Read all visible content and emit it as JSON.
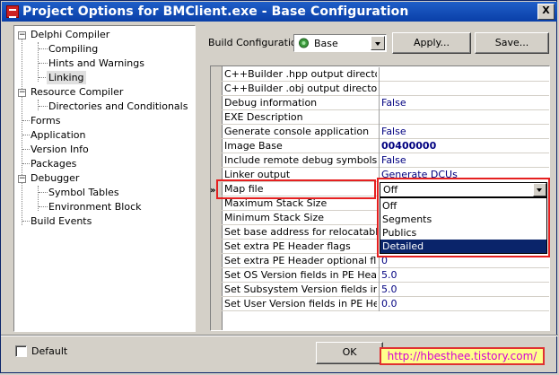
{
  "window": {
    "title": "Project Options for BMClient.exe - Base Configuration",
    "close_glyph": "X"
  },
  "tree": {
    "nodes": [
      {
        "label": "Delphi Compiler",
        "expander": "−"
      },
      {
        "label": "Compiling"
      },
      {
        "label": "Hints and Warnings"
      },
      {
        "label": "Linking",
        "selected": true
      },
      {
        "label": "Resource Compiler",
        "expander": "−"
      },
      {
        "label": "Directories and Conditionals"
      },
      {
        "label": "Forms"
      },
      {
        "label": "Application"
      },
      {
        "label": "Version Info"
      },
      {
        "label": "Packages"
      },
      {
        "label": "Debugger",
        "expander": "−"
      },
      {
        "label": "Symbol Tables"
      },
      {
        "label": "Environment Block"
      },
      {
        "label": "Build Events"
      }
    ]
  },
  "build_config": {
    "label": "Build Configuration",
    "value": "Base",
    "apply_label": "Apply...",
    "save_label": "Save..."
  },
  "grid": {
    "rows": [
      {
        "name": "C++Builder .hpp output directory",
        "value": ""
      },
      {
        "name": "C++Builder .obj output directory",
        "value": ""
      },
      {
        "name": "Debug information",
        "value": "False"
      },
      {
        "name": "EXE Description",
        "value": ""
      },
      {
        "name": "Generate console application",
        "value": "False"
      },
      {
        "name": "Image Base",
        "value": "00400000",
        "bold": true
      },
      {
        "name": "Include remote debug symbols",
        "value": "False"
      },
      {
        "name": "Linker output",
        "value": "Generate DCUs"
      },
      {
        "name": "Map file",
        "value": "Off"
      },
      {
        "name": "Maximum Stack Size",
        "value": ""
      },
      {
        "name": "Minimum Stack Size",
        "value": ""
      },
      {
        "name": "Set base address for relocatable images",
        "value": ""
      },
      {
        "name": "Set extra PE Header flags",
        "value": ""
      },
      {
        "name": "Set extra PE Header optional flags",
        "value": "0"
      },
      {
        "name": "Set OS Version fields in PE Header",
        "value": "5.0"
      },
      {
        "name": "Set Subsystem Version fields in PE Header",
        "value": "5.0"
      },
      {
        "name": "Set User Version fields in PE Header",
        "value": "0.0"
      }
    ],
    "marker": "»"
  },
  "map_dropdown": {
    "current": "Off",
    "options": [
      "Off",
      "Segments",
      "Publics",
      "Detailed"
    ],
    "selected_index": 3
  },
  "footer": {
    "default_label": "Default",
    "ok_label": "OK"
  },
  "watermark": "http://hbesthee.tistory.com/",
  "colors": {
    "titlebar": "#0a3fa8",
    "value_text": "#000080",
    "highlight_border": "#e52020",
    "selection": "#0a246a"
  }
}
